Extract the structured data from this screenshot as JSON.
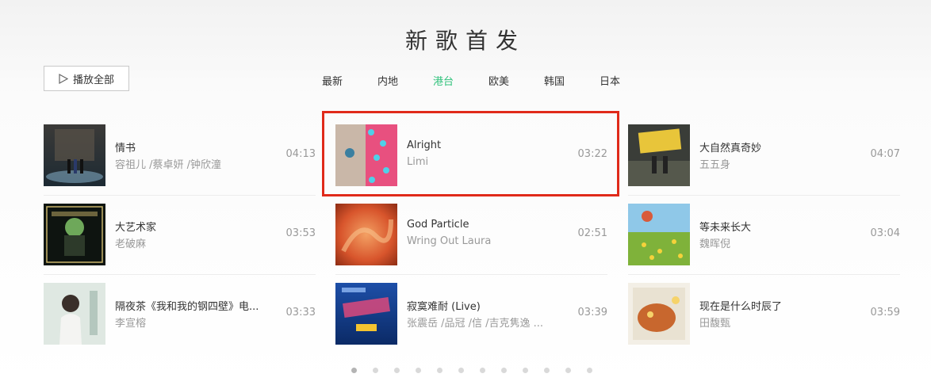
{
  "section_title": "新歌首发",
  "play_all_label": "播放全部",
  "tabs": [
    {
      "label": "最新",
      "active": false
    },
    {
      "label": "内地",
      "active": false
    },
    {
      "label": "港台",
      "active": true
    },
    {
      "label": "欧美",
      "active": false
    },
    {
      "label": "韩国",
      "active": false
    },
    {
      "label": "日本",
      "active": false
    }
  ],
  "accent_color": "#31c27c",
  "highlight_color": "#e02a1a",
  "songs": [
    {
      "title": "情书",
      "artist": "容祖儿 /蔡卓妍 /钟欣潼",
      "duration": "04:13"
    },
    {
      "title": "大艺术家",
      "artist": "老破麻",
      "duration": "03:53"
    },
    {
      "title": "隔夜茶《我和我的钢四壁》电...",
      "artist": "李宣榕",
      "duration": "03:33"
    },
    {
      "title": "Alright",
      "artist": "Limi",
      "duration": "03:22"
    },
    {
      "title": "God Particle",
      "artist": "Wring Out Laura",
      "duration": "02:51"
    },
    {
      "title": "寂寞难耐 (Live)",
      "artist": "张震岳 /品冠 /信 /吉克隽逸 ...",
      "duration": "03:39"
    },
    {
      "title": "大自然真奇妙",
      "artist": "五五身",
      "duration": "04:07"
    },
    {
      "title": "等未来长大",
      "artist": "魏晖倪",
      "duration": "03:04"
    },
    {
      "title": "现在是什么时辰了",
      "artist": "田馥甄",
      "duration": "03:59"
    }
  ],
  "pagination": {
    "page_count": 12,
    "current_page": 1
  }
}
